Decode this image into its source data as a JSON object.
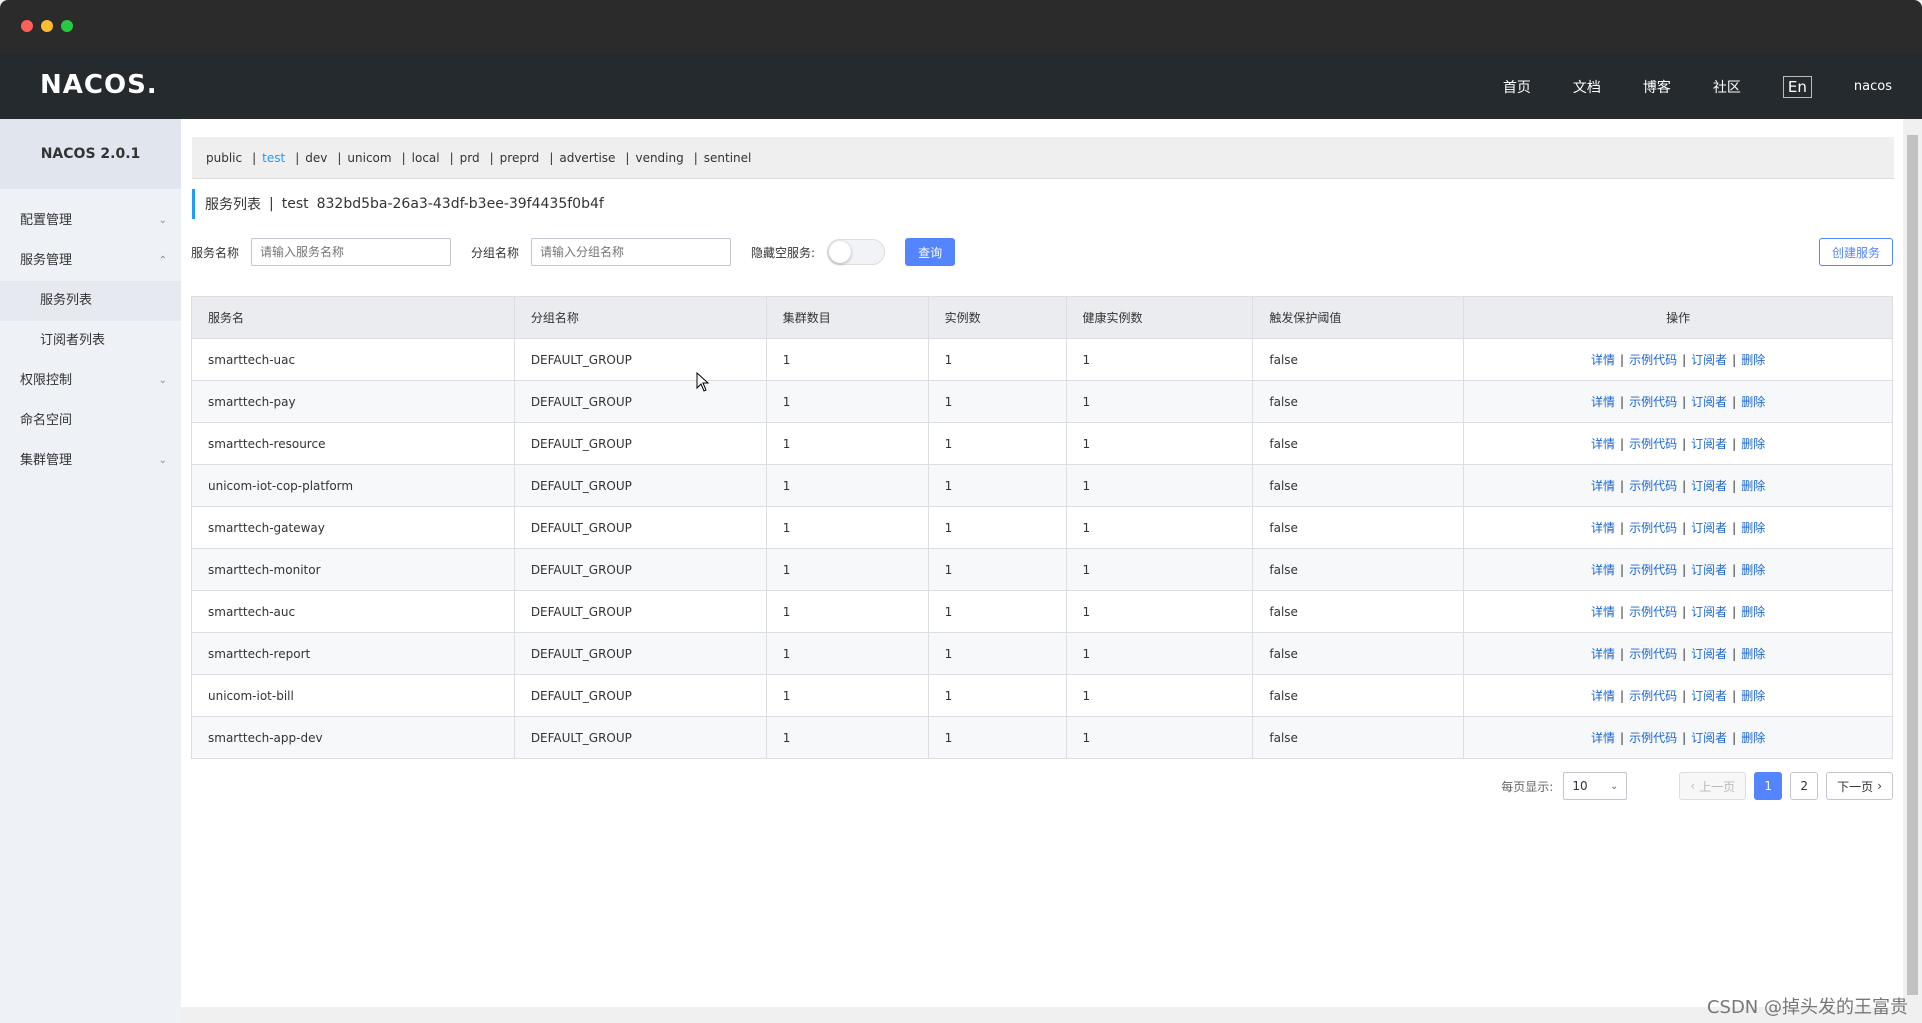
{
  "app": {
    "logo": "NACOS.",
    "version": "NACOS 2.0.1"
  },
  "topnav": {
    "home": "首页",
    "docs": "文档",
    "blog": "博客",
    "community": "社区",
    "lang": "En",
    "user": "nacos"
  },
  "sidebar": {
    "config": "配置管理",
    "service": "服务管理",
    "service_list": "服务列表",
    "subscriber_list": "订阅者列表",
    "auth": "权限控制",
    "namespace": "命名空间",
    "cluster": "集群管理"
  },
  "namespaces": [
    "public",
    "test",
    "dev",
    "unicom",
    "local",
    "prd",
    "preprd",
    "advertise",
    "vending",
    "sentinel"
  ],
  "page_head": {
    "title": "服务列表",
    "sep": "|",
    "ns_name": "test",
    "ns_id": "832bd5ba-26a3-43df-b3ee-39f4435f0b4f"
  },
  "filter": {
    "service_label": "服务名称",
    "service_placeholder": "请输入服务名称",
    "group_label": "分组名称",
    "group_placeholder": "请输入分组名称",
    "hide_empty_label": "隐藏空服务:",
    "query_button": "查询",
    "create_button": "创建服务"
  },
  "table": {
    "headers": [
      "服务名",
      "分组名称",
      "集群数目",
      "实例数",
      "健康实例数",
      "触发保护阈值",
      "操作"
    ],
    "ops": [
      "详情",
      "示例代码",
      "订阅者",
      "删除"
    ],
    "rows": [
      [
        "smarttech-uac",
        "DEFAULT_GROUP",
        "1",
        "1",
        "1",
        "false"
      ],
      [
        "smarttech-pay",
        "DEFAULT_GROUP",
        "1",
        "1",
        "1",
        "false"
      ],
      [
        "smarttech-resource",
        "DEFAULT_GROUP",
        "1",
        "1",
        "1",
        "false"
      ],
      [
        "unicom-iot-cop-platform",
        "DEFAULT_GROUP",
        "1",
        "1",
        "1",
        "false"
      ],
      [
        "smarttech-gateway",
        "DEFAULT_GROUP",
        "1",
        "1",
        "1",
        "false"
      ],
      [
        "smarttech-monitor",
        "DEFAULT_GROUP",
        "1",
        "1",
        "1",
        "false"
      ],
      [
        "smarttech-auc",
        "DEFAULT_GROUP",
        "1",
        "1",
        "1",
        "false"
      ],
      [
        "smarttech-report",
        "DEFAULT_GROUP",
        "1",
        "1",
        "1",
        "false"
      ],
      [
        "unicom-iot-bill",
        "DEFAULT_GROUP",
        "1",
        "1",
        "1",
        "false"
      ],
      [
        "smarttech-app-dev",
        "DEFAULT_GROUP",
        "1",
        "1",
        "1",
        "false"
      ]
    ]
  },
  "pager": {
    "per_page_label": "每页显示:",
    "per_page_value": "10",
    "prev": "上一页",
    "next": "下一页",
    "pages": [
      "1",
      "2"
    ],
    "current": "1"
  },
  "watermark": "CSDN @掉头发的王富贵",
  "colors": {
    "primary": "#5584ff",
    "link": "#1a66d2",
    "active_ns": "#209bfa",
    "topbar": "#252a2f"
  }
}
